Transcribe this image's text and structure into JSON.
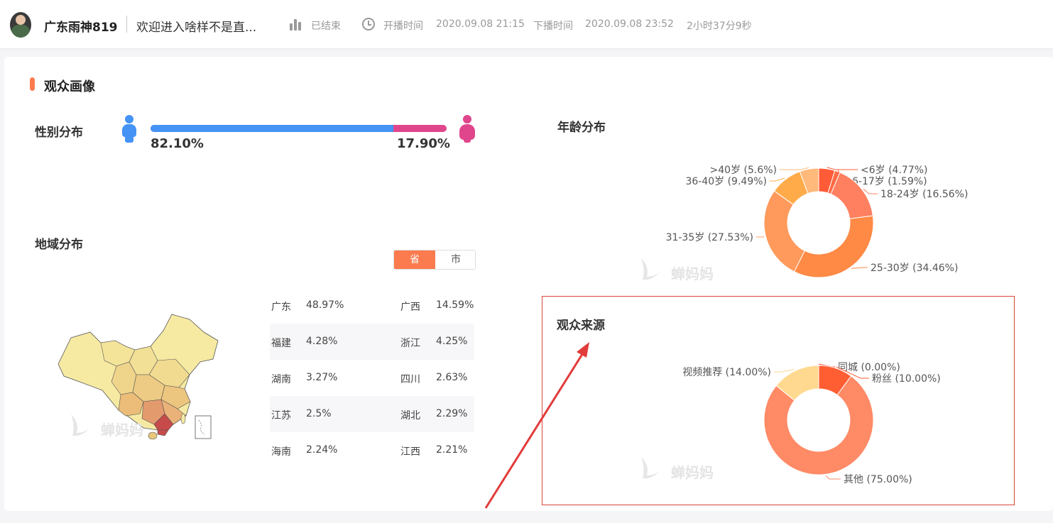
{
  "header": {
    "anchor_name": "广东雨神819",
    "room_title": "欢迎进入啥样不是直...",
    "status": "已结束",
    "start_label": "开播时间",
    "start_time": "2020.09.08 21:15",
    "end_label": "下播时间",
    "end_time": "2020.09.08 23:52",
    "duration": "2小时37分9秒"
  },
  "section_title": "观众画像",
  "gender": {
    "title": "性别分布",
    "male_pct": 82.1,
    "male_label": "82.10%",
    "female_label": "17.90%",
    "colors": {
      "male": "#4593f5",
      "female": "#e0468c"
    }
  },
  "region": {
    "title": "地域分布",
    "toggle": {
      "province": "省",
      "city": "市"
    },
    "rows": [
      {
        "left_name": "广东",
        "left_val": "48.97%",
        "right_name": "广西",
        "right_val": "14.59%"
      },
      {
        "left_name": "福建",
        "left_val": "4.28%",
        "right_name": "浙江",
        "right_val": "4.25%"
      },
      {
        "left_name": "湖南",
        "left_val": "3.27%",
        "right_name": "四川",
        "right_val": "2.63%"
      },
      {
        "left_name": "江苏",
        "left_val": "2.5%",
        "right_name": "湖北",
        "right_val": "2.29%"
      },
      {
        "left_name": "海南",
        "left_val": "2.24%",
        "right_name": "江西",
        "right_val": "2.21%"
      }
    ]
  },
  "watermark": "蝉妈妈",
  "chart_data": [
    {
      "type": "pie",
      "title": "年龄分布",
      "categories": [
        "<6岁",
        "6-17岁",
        "18-24岁",
        "25-30岁",
        "31-35岁",
        "36-40岁",
        ">40岁"
      ],
      "values": [
        4.77,
        1.59,
        16.56,
        34.46,
        27.53,
        9.49,
        5.6
      ],
      "labels": [
        "<6岁 (4.77%)",
        "6-17岁 (1.59%)",
        "18-24岁 (16.56%)",
        "25-30岁 (34.46%)",
        "31-35岁 (27.53%)",
        "36-40岁 (9.49%)",
        ">40岁 (5.6%)"
      ],
      "colors": [
        "#ff5b36",
        "#ff6b45",
        "#ff8060",
        "#ff8a45",
        "#ff9a5c",
        "#ffab4a",
        "#ffb97a"
      ]
    },
    {
      "type": "pie",
      "title": "观众来源",
      "categories": [
        "同城",
        "粉丝",
        "其他",
        "视频推荐"
      ],
      "values": [
        0.0,
        10.0,
        75.0,
        14.0
      ],
      "labels": [
        "同城 (0.00%)",
        "粉丝 (10.00%)",
        "其他 (75.00%)",
        "视频推荐 (14.00%)"
      ],
      "colors": [
        "#ff4a2a",
        "#ff5e33",
        "#ff8a66",
        "#ffd98f"
      ]
    }
  ]
}
